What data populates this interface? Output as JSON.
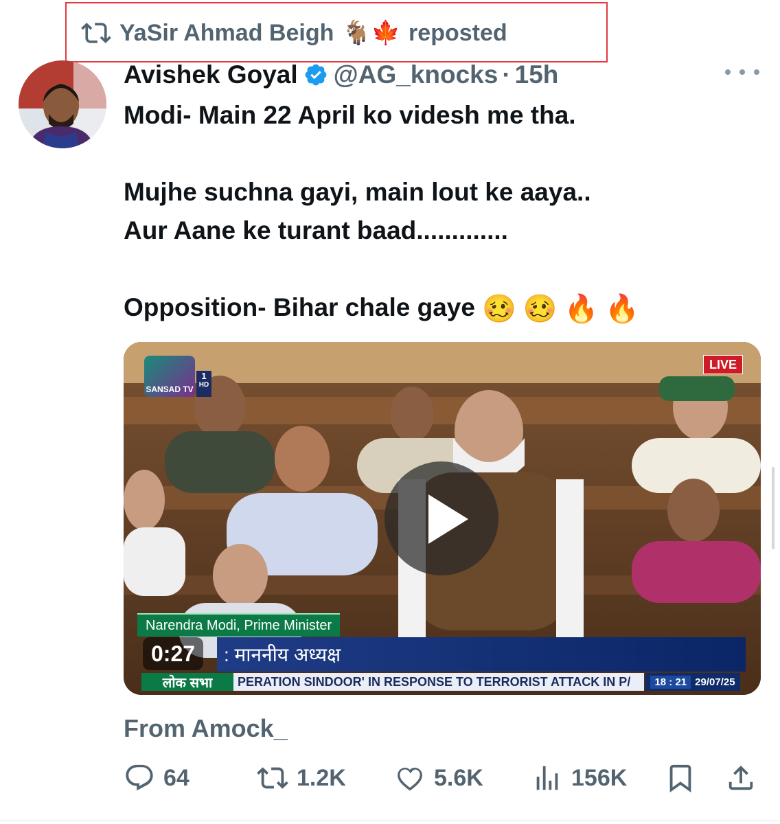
{
  "repost": {
    "user": "YaSir Ahmad Beigh",
    "emoji": "🐐🍁",
    "suffix": "reposted"
  },
  "author": {
    "name": "Avishek Goyal",
    "handle": "@AG_knocks",
    "time": "15h",
    "verified": true
  },
  "tweet": {
    "text": "Modi- Main 22 April ko videsh me tha.\n\nMujhe suchna gayi, main lout ke aaya..\nAur Aane ke turant baad.............\n\nOpposition- Bihar chale gaye",
    "emojis": [
      "🥴",
      "🥴",
      "🔥",
      "🔥"
    ]
  },
  "video": {
    "duration": "0:27",
    "live_badge": "LIVE",
    "channel_logo": "SANSAD TV",
    "channel_number": "1",
    "channel_hd": "HD",
    "speaker_caption": "Narendra Modi, Prime Minister",
    "title_caption": ": माननीय अध्यक्ष",
    "ticker_label": "लोक सभा",
    "ticker_text": "PERATION SINDOOR' IN RESPONSE TO TERRORIST ATTACK IN P/",
    "ticker_time": "18 : 21",
    "ticker_date": "29/07/25"
  },
  "source": "From Amock_",
  "actions": {
    "replies": "64",
    "reposts": "1.2K",
    "likes": "5.6K",
    "views": "156K"
  },
  "colors": {
    "accent_blue": "#1d9bf0",
    "secondary_text": "#536471",
    "highlight_border": "#e0393e"
  }
}
